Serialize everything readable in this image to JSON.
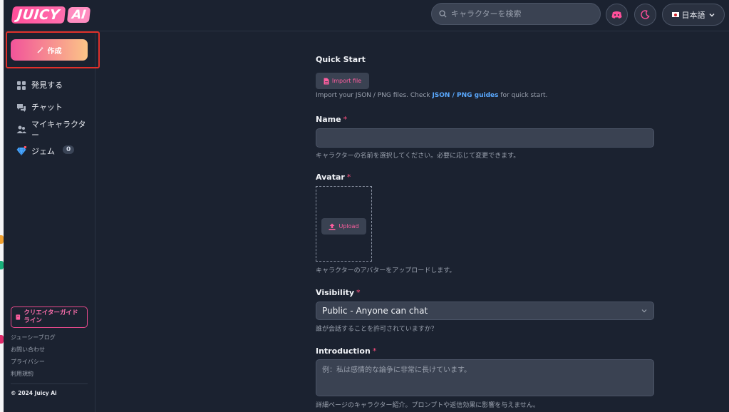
{
  "brand": {
    "name_main": "JUICY",
    "name_sub": "AI"
  },
  "header": {
    "search_placeholder": "キャラクターを検索",
    "language_label": "日本語",
    "icons": {
      "discord": "discord-icon",
      "theme": "moon-icon",
      "language": "flag-jp-icon",
      "chevron": "chevron-down-icon"
    }
  },
  "colors": {
    "accent": "#ff4f9a",
    "gradient_end": "#fbc487",
    "link": "#5aa9ff",
    "required": "#ff4f7e",
    "highlight": "#e0302a"
  },
  "sidebar": {
    "create_label": "作成",
    "items": [
      {
        "label": "発見する",
        "icon": "grid-icon"
      },
      {
        "label": "チャット",
        "icon": "chat-icon"
      },
      {
        "label": "マイキャラクター",
        "icon": "users-icon"
      },
      {
        "label": "ジェム",
        "icon": "gem-icon",
        "count": "0"
      }
    ],
    "guide_label": "クリエイターガイドライン",
    "footer_links": [
      "ジューシーブログ",
      "お問い合わせ",
      "プライバシー",
      "利用規約"
    ],
    "copyright": "© 2024 Juicy Ai"
  },
  "form": {
    "quick_start": {
      "title": "Quick Start",
      "import_label": "Import file",
      "hint_prefix": "Import your JSON / PNG files. Check ",
      "hint_link": "JSON / PNG guides",
      "hint_suffix": " for quick start."
    },
    "name": {
      "label": "Name",
      "required_mark": "*",
      "value": "",
      "hint": "キャラクターの名前を選択してください。必要に応じて変更できます。"
    },
    "avatar": {
      "label": "Avatar",
      "required_mark": "*",
      "upload_label": "Upload",
      "hint": "キャラクターのアバターをアップロードします。"
    },
    "visibility": {
      "label": "Visibility",
      "required_mark": "*",
      "selected": "Public - Anyone can chat",
      "hint": "誰が会話することを許可されていますか？"
    },
    "introduction": {
      "label": "Introduction",
      "required_mark": "*",
      "placeholder": "例：私は感情的な論争に非常に長けています。",
      "hint": "詳細ページのキャラクター紹介。プロンプトや返信効果に影響を与えません。"
    }
  }
}
